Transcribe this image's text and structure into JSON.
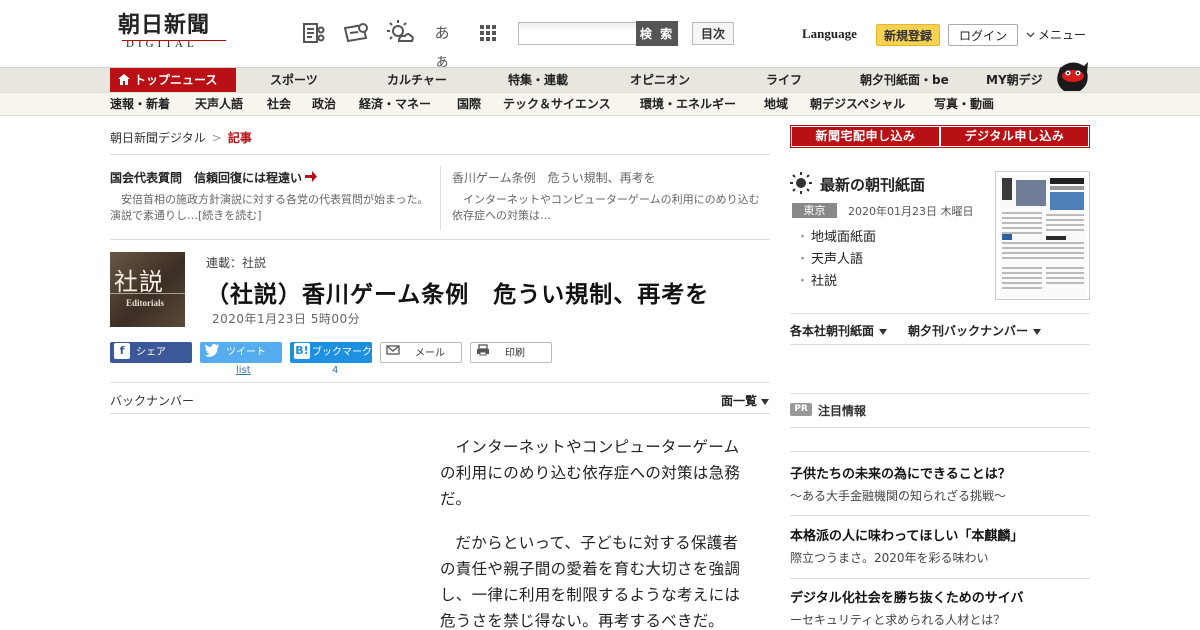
{
  "header": {
    "logo_main": "朝日新聞",
    "logo_sub": "DIGITAL",
    "search_placeholder": "",
    "search_button": "検 索",
    "toc_button": "目次",
    "language": "Language",
    "register": "新規登録",
    "login": "ログイン",
    "menu": "メニュー",
    "font_size_label": "あぁ"
  },
  "nav": {
    "top": [
      {
        "label": "トップニュース",
        "active": true
      },
      {
        "label": "スポーツ"
      },
      {
        "label": "カルチャー"
      },
      {
        "label": "特集・連載"
      },
      {
        "label": "オピニオン"
      },
      {
        "label": "ライフ"
      },
      {
        "label": "朝夕刊紙面・be"
      },
      {
        "label": "MY朝デジ"
      }
    ],
    "sub": [
      {
        "label": "速報・新着"
      },
      {
        "label": "天声人語"
      },
      {
        "label": "社会"
      },
      {
        "label": "政治"
      },
      {
        "label": "経済・マネー"
      },
      {
        "label": "国際"
      },
      {
        "label": "テック＆サイエンス"
      },
      {
        "label": "環境・エネルギー"
      },
      {
        "label": "地域"
      },
      {
        "label": "朝デジスペシャル"
      },
      {
        "label": "写真・動画"
      }
    ]
  },
  "breadcrumb": {
    "home": "朝日新聞デジタル",
    "sep": ">",
    "current": "記事"
  },
  "related": [
    {
      "title": "国会代表質問　信頼回復には程遠い",
      "desc": "安倍首相の施政方針演説に対する各党の代表質問が始まった。演説で素通りし…[続きを読む]"
    },
    {
      "title": "香川ゲーム条例　危うい規制、再考を",
      "desc": "インターネットやコンピューターゲームの利用にのめり込む依存症への対策は…"
    }
  ],
  "article": {
    "badge_kanji": "社説",
    "badge_en": "Editorials",
    "series": "連載：社説",
    "title": "（社説）香川ゲーム条例　危うい規制、再考を",
    "date": "2020年1月23日 5時00分",
    "paragraphs": [
      "インターネットやコンピューターゲームの利用にのめり込む依存症への対策は急務だ。",
      "だからといって、子どもに対する保護者の責任や親子間の愛着を育む大切さを強調し、一律に利用を制限するような考えには危うさを禁じ得ない。再考するべきだ。"
    ]
  },
  "share": {
    "facebook": "シェア",
    "twitter": "ツイート",
    "hatena": "ブックマーク",
    "mail": "メール",
    "print": "印刷",
    "twitter_count": "list",
    "hatena_count": "4"
  },
  "backnumber": {
    "label": "バックナンバー",
    "page_list": "面一覧"
  },
  "sidebar": {
    "subscribe_paper": "新聞宅配申し込み",
    "subscribe_digital": "デジタル申し込み",
    "paper_heading": "最新の朝刊紙面",
    "region": "東京",
    "paper_date": "2020年01月23日 木曜日",
    "paper_links": [
      "地域面紙面",
      "天声人語",
      "社説"
    ],
    "dropdown_regional": "各本社朝刊紙面",
    "dropdown_back": "朝夕刊バックナンバー",
    "pr_tag": "PR",
    "pr_heading": "注目情報",
    "promos": [
      {
        "title": "子供たちの未来の為にできることは？",
        "sub": "～ある大手金融機関の知られざる挑戦～"
      },
      {
        "title": "本格派の人に味わってほしい「本麒麟」",
        "sub": "際立つうまさ。2020年を彩る味わい"
      },
      {
        "title": "デジタル化社会を勝ち抜くためのサイバ",
        "sub": "ーセキュリティと求められる人材とは？"
      }
    ]
  },
  "colors": {
    "brand_red": "#b81014",
    "register_yellow": "#f7d151",
    "facebook": "#3b5998",
    "twitter": "#55acee",
    "hatena": "#1f90e0"
  }
}
